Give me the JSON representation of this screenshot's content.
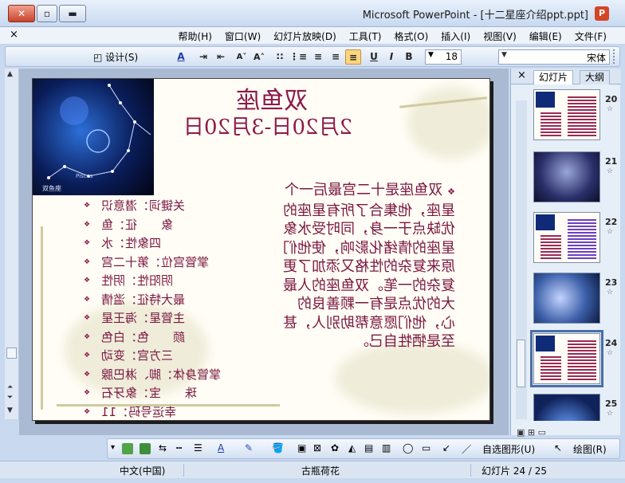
{
  "window": {
    "title": "Microsoft PowerPoint - [十二星座介绍ppt.ppt]",
    "close_label": "✕",
    "maximize_label": "▫",
    "minimize_label": "▬",
    "app_icon_label": "P"
  },
  "menubar": {
    "close_label": "×",
    "items": [
      "文件(F)",
      "编辑(E)",
      "视图(V)",
      "插入(I)",
      "格式(O)",
      "工具(T)",
      "幻灯片放映(D)",
      "窗口(W)",
      "帮助(H)"
    ]
  },
  "toolbar": {
    "font_name": "宋体",
    "font_size": "18",
    "bold": "B",
    "italic": "I",
    "underline": "U",
    "shadow": "S",
    "design_label": "设计(S)",
    "grow_font": "A˄",
    "shrink_font": "A˅",
    "font_color_label": "A"
  },
  "slide": {
    "title": "双鱼座",
    "date_range": "2月20日-3月20日",
    "photo_label_en": "Pisces",
    "photo_label_cn": "双鱼座",
    "list": [
      "关键词：潜意识",
      "象　　征：鱼",
      "四象性：水",
      "掌管宫位：第十二宫",
      "阴阳性：阴性",
      "最大特征：滥情",
      "主管星：海王星",
      "颜　　色：白色",
      "三方宫：变动",
      "掌管身体：脚、淋巴腺",
      "珠　　宝：象牙石",
      "幸运号码：11"
    ],
    "paragraph": "双鱼座是十二宫最后一个星座，他集合了所有星座的优缺点于一身，同时受水象星座的情绪化影响，使他们原来复杂的性格又添加了更复杂的一笔。双鱼座的人最大的优点是有一颗善良的心，他们愿意帮助别人，甚至是牺牲自己。"
  },
  "pane": {
    "close_label": "×",
    "tab_slides": "幻灯片",
    "tab_outline": "大纲",
    "thumbnails": [
      {
        "number": "20",
        "star": "☆"
      },
      {
        "number": "21",
        "star": "☆"
      },
      {
        "number": "22",
        "star": "☆"
      },
      {
        "number": "23",
        "star": "☆"
      },
      {
        "number": "24",
        "star": "☆"
      },
      {
        "number": "25",
        "star": "☆"
      }
    ],
    "view_buttons": "▣ ⊞ ▭"
  },
  "drawbar": {
    "draw_label": "绘图(R)",
    "autoshapes_label": "自选图形(U)",
    "font_color_label": "A"
  },
  "statusbar": {
    "slide_position": "幻灯片 24 / 25",
    "theme": "古瓶荷花",
    "language": "中文(中国)"
  },
  "colors": {
    "accent": "#8c1a4a",
    "title_bar": "#c8d9f0",
    "selection": "#4a6ea9"
  }
}
